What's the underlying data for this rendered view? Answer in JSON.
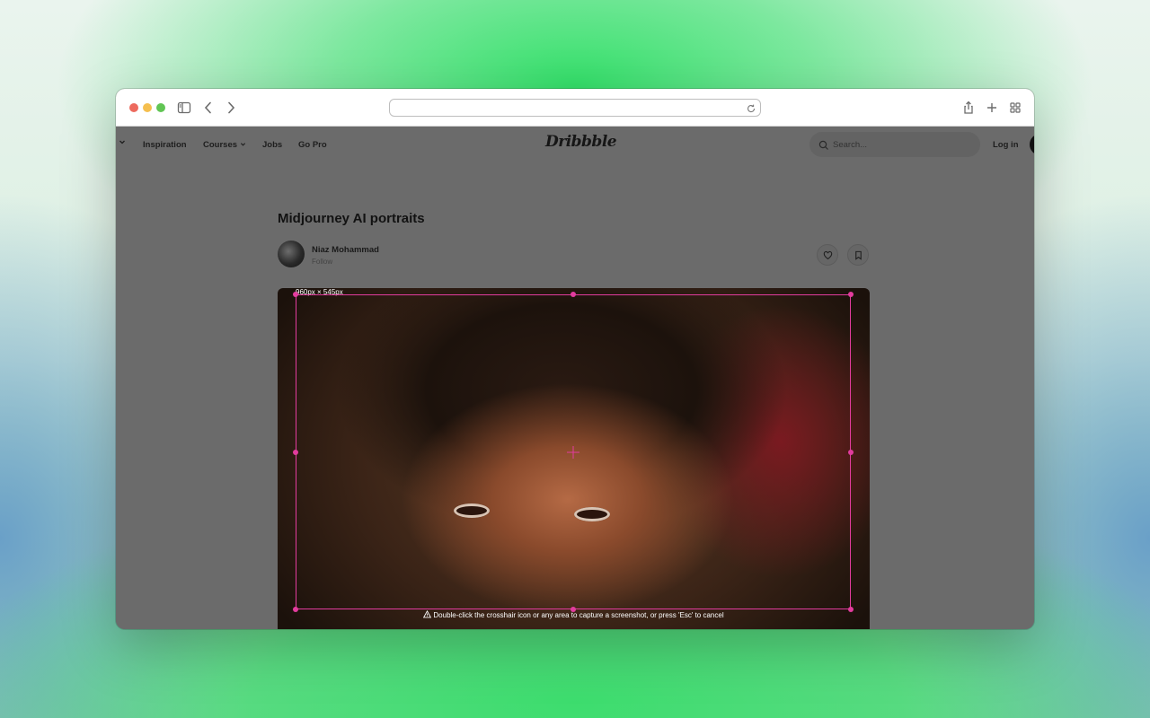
{
  "browser": {
    "url": "",
    "buttons": {
      "sidebar": "sidebar-toggle",
      "back": "chevron-left",
      "forward": "chevron-right",
      "reload": "reload",
      "share": "share",
      "new_tab": "plus",
      "tab_overview": "grid"
    }
  },
  "nav": {
    "items": [
      "Inspiration",
      "Courses",
      "Jobs",
      "Go Pro"
    ],
    "logo": "Dribbble",
    "search_placeholder": "Search...",
    "login": "Log in"
  },
  "shot": {
    "title": "Midjourney AI portraits",
    "author": "Niaz Mohammad",
    "follow": "Follow"
  },
  "capture": {
    "dimensions": "960px × 545px",
    "hint": "Double-click the crosshair icon or any area to capture a screenshot, or press 'Esc' to cancel",
    "accent_color": "#e23c9e"
  }
}
